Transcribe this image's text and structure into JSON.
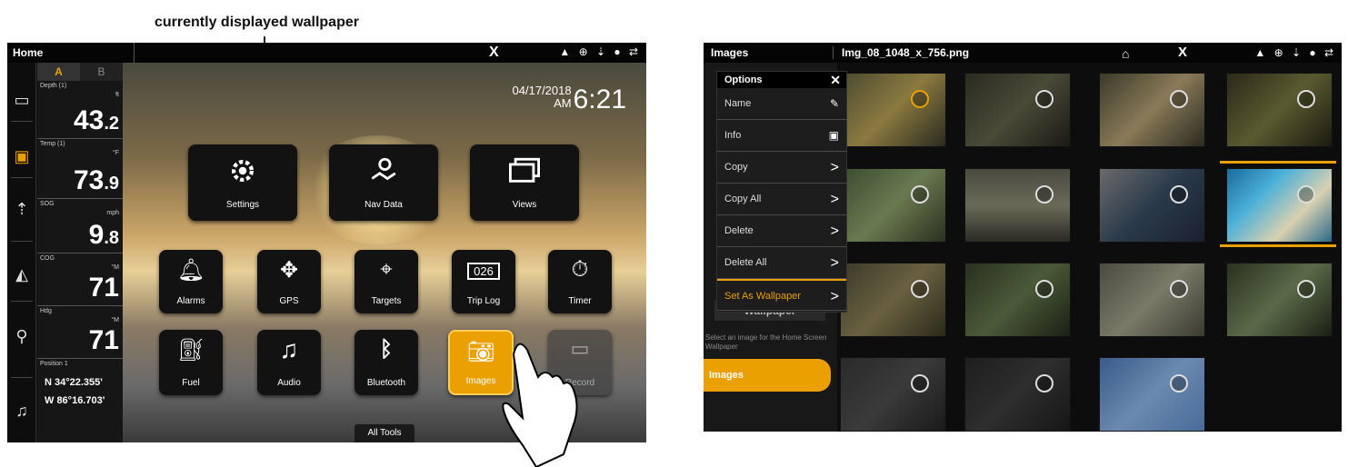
{
  "caption": "currently displayed wallpaper",
  "left": {
    "title": "Home",
    "close_glyph": "X",
    "status_icons": "▲ ⊕ ⇣ ● ⇄",
    "tabs": [
      "A",
      "B"
    ],
    "date": "04/17/2018",
    "ampm": "AM",
    "time": "6:21",
    "datafields": [
      {
        "label": "Depth (1)",
        "unit": "ft",
        "value": "43",
        "decimal": ".2"
      },
      {
        "label": "Temp (1)",
        "unit": "°F",
        "value": "73",
        "decimal": ".9"
      },
      {
        "label": "SOG",
        "unit": "mph",
        "value": "9",
        "decimal": ".8"
      },
      {
        "label": "COG",
        "unit": "°M",
        "value": "71",
        "decimal": ""
      },
      {
        "label": "Hdg",
        "unit": "°M",
        "value": "71",
        "decimal": ""
      }
    ],
    "position_label": "Position 1",
    "lat": "N 34°22.355'",
    "lon": "W 86°16.703'",
    "tiles": {
      "settings": "Settings",
      "navdata": "Nav Data",
      "views": "Views",
      "alarms": "Alarms",
      "gps": "GPS",
      "targets": "Targets",
      "triplog": "Trip Log",
      "timer": "Timer",
      "fuel": "Fuel",
      "audio": "Audio",
      "bluetooth": "Bluetooth",
      "images": "Images",
      "record": "Record"
    },
    "all_tools": "All Tools"
  },
  "right": {
    "title": "Images",
    "filename": "Img_08_1048_x_756.png",
    "close_glyph": "X",
    "menu_title": "Options",
    "menu_items": [
      "Name",
      "Info",
      "Copy",
      "Copy All",
      "Delete",
      "Delete All",
      "Set As Wallpaper"
    ],
    "wallpaper_button": "Wallpaper",
    "wallpaper_hint": "Select an image for the Home Screen Wallpaper",
    "images_tab": "Images"
  },
  "colors": {
    "accent": "#e9a000"
  }
}
